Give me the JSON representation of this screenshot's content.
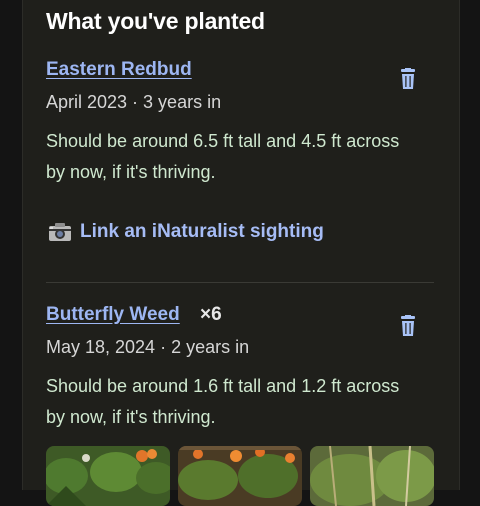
{
  "section_title": "What you've planted",
  "plants": [
    {
      "name": "Eastern Redbud",
      "quantity": "",
      "meta": "April 2023 · 3 years in",
      "description": "Should be around 6.5 ft tall and 4.5 ft across by now, if it's thriving.",
      "link_label": "Link an iNaturalist sighting"
    },
    {
      "name": "Butterfly Weed",
      "quantity": "×6",
      "meta": "May 18, 2024 · 2 years in",
      "description": "Should be around 1.6 ft tall and 1.2 ft across by now, if it's thriving."
    }
  ],
  "icons": {
    "delete": "trash-icon",
    "camera": "camera-icon"
  },
  "colors": {
    "link": "#9db6f2",
    "description": "#cfe8cf",
    "panel": "#1f1f1b"
  }
}
